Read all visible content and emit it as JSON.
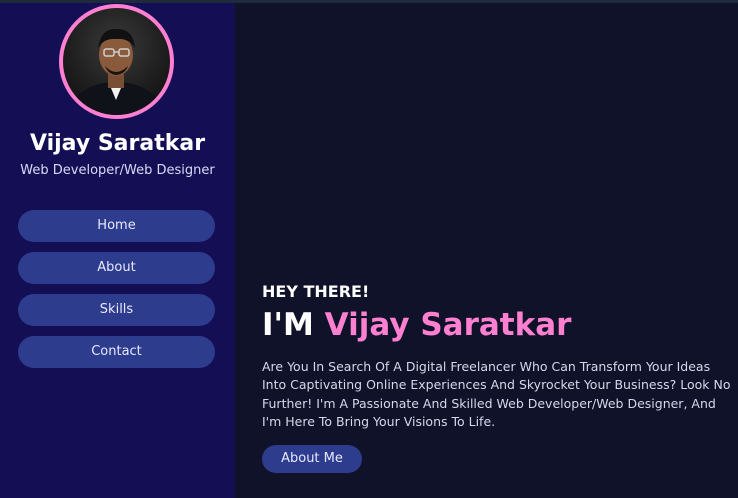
{
  "profile": {
    "name": "Vijay Saratkar",
    "role": "Web Developer/Web Designer"
  },
  "nav": {
    "home": "Home",
    "about": "About",
    "skills": "Skills",
    "contact": "Contact"
  },
  "hero": {
    "greeting": "HEY THERE!",
    "intro_prefix": "I'M",
    "intro_name": "Vijay Saratkar",
    "description": "Are You In Search Of A Digital Freelancer Who Can Transform Your Ideas Into Captivating Online Experiences And Skyrocket Your Business? Look No Further! I'm A Passionate And Skilled Web Developer/Web Designer, And I'm Here To Bring Your Visions To Life.",
    "cta": "About Me"
  },
  "colors": {
    "sidebar": "#140f55",
    "main": "#0f1228",
    "accent_pink": "#ff7fd1",
    "button": "#2e3c8e"
  }
}
